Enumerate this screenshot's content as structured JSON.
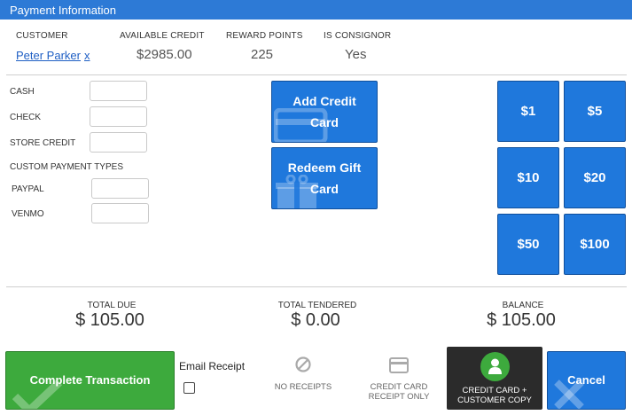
{
  "title": "Payment Information",
  "header": {
    "customer_label": "CUSTOMER",
    "customer_name": "Peter Parker",
    "customer_remove": "x",
    "available_credit_label": "AVAILABLE CREDIT",
    "available_credit": "$2985.00",
    "reward_points_label": "REWARD POINTS",
    "reward_points": "225",
    "consignor_label": "IS CONSIGNOR",
    "consignor": "Yes"
  },
  "payments": {
    "cash": "CASH",
    "check": "CHECK",
    "store_credit": "STORE CREDIT",
    "custom_types_label": "CUSTOM PAYMENT TYPES",
    "paypal": "PAYPAL",
    "venmo": "VENMO"
  },
  "actions": {
    "add_credit_line1": "Add Credit",
    "add_credit_line2": "Card",
    "redeem_gift_line1": "Redeem Gift",
    "redeem_gift_line2": "Card"
  },
  "quick_cash": [
    "$1",
    "$5",
    "$10",
    "$20",
    "$50",
    "$100"
  ],
  "totals": {
    "due_label": "TOTAL DUE",
    "due": "$ 105.00",
    "tendered_label": "TOTAL TENDERED",
    "tendered": "$ 0.00",
    "balance_label": "BALANCE",
    "balance": "$ 105.00"
  },
  "footer": {
    "complete": "Complete Transaction",
    "email_receipt": "Email Receipt",
    "no_receipts": "NO RECEIPTS",
    "cc_receipt_line1": "CREDIT CARD",
    "cc_receipt_line2": "RECEIPT ONLY",
    "cc_copy_line1": "CREDIT CARD +",
    "cc_copy_line2": "CUSTOMER COPY",
    "cancel": "Cancel"
  },
  "colors": {
    "header_blue": "#2d7ad6",
    "button_blue": "#1f78dc",
    "complete_green": "#3daa3d",
    "dark_button": "#2b2b2b"
  }
}
